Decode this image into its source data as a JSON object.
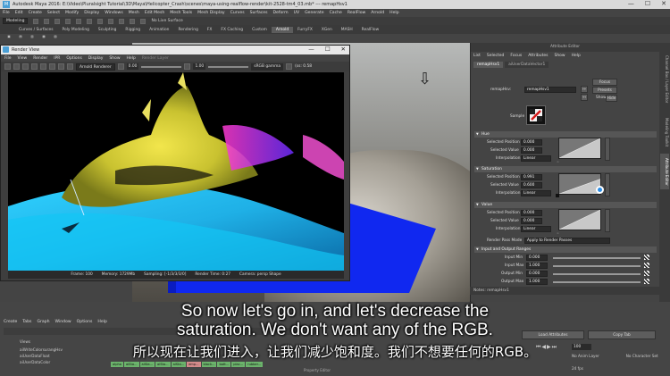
{
  "window": {
    "title": "Autodesk Maya 2016: E:\\Video\\Pluralsight Tutorial\\3D\\Maya\\Helicopter_Crash\\scenes\\maya-using-realflow-render\\kit-2528-tm4_03.mb* --- remapHsv1",
    "minimize": "—",
    "maximize": "☐",
    "close": "✕"
  },
  "menubar": [
    "File",
    "Edit",
    "Create",
    "Select",
    "Modify",
    "Display",
    "Windows",
    "Mesh",
    "Edit Mesh",
    "Mesh Tools",
    "Mesh Display",
    "Curves",
    "Surfaces",
    "Deform",
    "UV",
    "Generate",
    "Cache",
    "RealFlow",
    "Arnold",
    "Help"
  ],
  "statusline": {
    "mode": "Modeling",
    "live_surface": "No Live Surface"
  },
  "shelf_tabs": [
    "Curves / Surfaces",
    "Poly Modeling",
    "Sculpting",
    "Rigging",
    "Animation",
    "Rendering",
    "FX",
    "FX Caching",
    "Custom",
    "Arnold",
    "FurryFX",
    "XGen",
    "MASH",
    "RealFlow"
  ],
  "shelf_active": "Arnold",
  "render_view": {
    "title": "Render View",
    "menu": [
      "File",
      "View",
      "Render",
      "IPR",
      "Options",
      "Display",
      "Show",
      "Help"
    ],
    "menu_dim": "Render Layer",
    "renderer": "Arnold Renderer",
    "exposure": "0.00",
    "gamma_value": "1.00",
    "gamma_mode": "sRGB gamma",
    "zoom": "(ss: 0.58",
    "status": {
      "frame": "Frame: 100",
      "memory": "Memory: 1729Mb",
      "sampling": "Sampling: [-1/3/3/3/0]",
      "render_time": "Render Time: 0:27",
      "camera": "Camera: persp Shape"
    }
  },
  "attribute_editor": {
    "title": "Attribute Editor",
    "menu": [
      "List",
      "Selected",
      "Focus",
      "Attributes",
      "Show",
      "Help"
    ],
    "tabs": [
      "remapHsv1",
      "aiUserDataVector1"
    ],
    "node_label": "remapHsv:",
    "node_name": "remapHsv1",
    "focus_btn": "Focus",
    "presets_btn": "Presets",
    "show_label": "Show",
    "hide_label": "Hide",
    "sample_label": "Sample",
    "sections": {
      "hue": "Hue",
      "saturation": "Saturation",
      "value": "Value",
      "input_output": "Input and Output Ranges"
    },
    "hue": {
      "pos_label": "Selected Position",
      "pos": "0.000",
      "val_label": "Selected Value",
      "val": "0.000",
      "interp_label": "Interpolation",
      "interp": "Linear"
    },
    "saturation": {
      "pos_label": "Selected Position",
      "pos": "0.991",
      "val_label": "Selected Value",
      "val": "0.600",
      "interp_label": "Interpolation",
      "interp": "Linear"
    },
    "value": {
      "pos_label": "Selected Position",
      "pos": "0.000",
      "val_label": "Selected Value",
      "val": "0.000",
      "interp_label": "Interpolation",
      "interp": "Linear"
    },
    "render_pass_label": "Render Pass Mode",
    "render_pass_value": "Apply to Render Passes",
    "io": {
      "input_min_label": "Input Min",
      "input_min": "0.000",
      "input_max_label": "Input Max",
      "input_max": "1.000",
      "output_min_label": "Output Min",
      "output_min": "0.000",
      "output_max_label": "Output Max",
      "output_max": "1.000"
    },
    "notes": "Notes:  remapHsv1"
  },
  "right_tabs": [
    "Channel Box / Layer Editor",
    "Modeling Toolkit",
    "Attribute Editor"
  ],
  "bottom": {
    "menu": [
      "Create",
      "Tabs",
      "Graph",
      "Window",
      "Options",
      "Help"
    ],
    "list_header": "Views",
    "list": [
      "aiWriteColorsurangHsv",
      "aiUserDataFloat",
      "aiUserDataColor"
    ],
    "tags": [
      "alpha",
      "aiSta...",
      "aiSta...",
      "aiSta...",
      "aiSta...",
      "emp...",
      "black...",
      "bott...",
      "plac...",
      "rubber..."
    ],
    "property_title": "Property Editor",
    "load_attributes": "Load Attributes",
    "copy_tab": "Copy Tab",
    "frame": "100",
    "anim_layer": "No Anim Layer",
    "char_set": "No Character Set",
    "fps": "24 fps"
  },
  "subtitles": {
    "en": "So now let's go in, and let's decrease the\nsaturation. We don't want any of the RGB.",
    "zh": "所以现在让我们进入，让我们减少饱和度。我们不想要任何的RGB。"
  }
}
